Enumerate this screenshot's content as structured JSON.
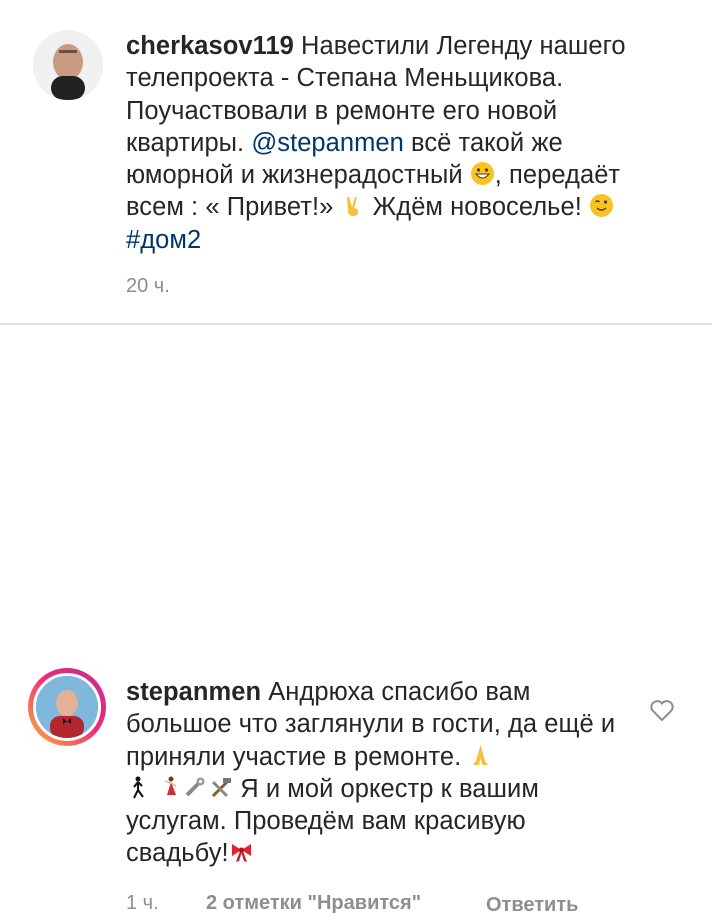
{
  "caption": {
    "username": "cherkasov119",
    "text_1": " Навестили Легенду нашего телепроекта - Степана Меньщикова. Поучаствовали в ремонте его новой квартиры. ",
    "mention": "@stepanmen",
    "text_2": " всё такой же юморной и жизнерадостный ",
    "text_3": ", передаёт всем : « Привет!» ",
    "text_4": " Ждём новоселье! ",
    "hashtag": "#дом2",
    "time": "20 ч.",
    "emojis": [
      "grinning-face-icon",
      "victory-hand-icon",
      "winking-face-icon"
    ]
  },
  "reply": {
    "username": "stepanmen",
    "text_1": " Андрюха спасибо вам большое что заглянули в гости, да ещё и приняли участие в ремонте. ",
    "text_2": " Я и мой оркестр к вашим услугам. Проведём вам красивую свадьбу!",
    "time": "1 ч.",
    "likes": "2 отметки \"Нравится\"",
    "reply_label": "Ответить",
    "emojis": [
      "folded-hands-icon",
      "dancer-man-icon",
      "dancer-woman-icon",
      "wrench-icon",
      "hammer-wrench-icon",
      "ribbon-bow-icon"
    ]
  },
  "colors": {
    "text": "#262626",
    "meta": "#8e8e8e",
    "link": "#00376b",
    "divider": "#e3e3e3"
  }
}
